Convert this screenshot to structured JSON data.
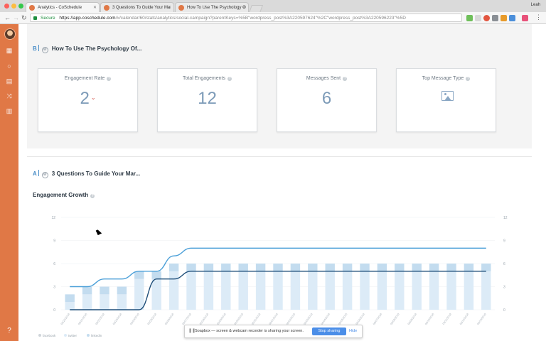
{
  "browser": {
    "tabs": [
      {
        "label": "Analytics - CoSchedule",
        "active": true
      },
      {
        "label": "3 Questions To Guide Your Ma",
        "active": false
      },
      {
        "label": "How To Use The Psychology O",
        "active": false
      }
    ],
    "user": "Leah",
    "secure_label": "Secure",
    "url_host": "https://app.coschedule.com",
    "url_path": "/#/calendar/60/stats/analytics/social-campaign?parentKeys=%5B\"wordpress_post%3A220597624\"%2C\"wordpress_post%3A220596223\"%5D"
  },
  "section_b": {
    "letter": "B",
    "title": "How To Use The Psychology Of...",
    "cards": [
      {
        "title": "Engagement Rate",
        "value": "2",
        "trend": "down"
      },
      {
        "title": "Total Engagements",
        "value": "12"
      },
      {
        "title": "Messages Sent",
        "value": "6"
      },
      {
        "title": "Top Message Type",
        "icon": "image-icon"
      }
    ]
  },
  "section_a": {
    "letter": "A",
    "title": "3 Questions To Guide Your Mar..."
  },
  "engagement_growth": {
    "title": "Engagement Growth",
    "legend": [
      "facebook",
      "twitter",
      "linkedin"
    ]
  },
  "chart_data": {
    "type": "bar",
    "ylim": [
      0,
      12
    ],
    "y_ticks": [
      0,
      3,
      6,
      9,
      12
    ],
    "right_y_ticks": [
      0,
      3,
      6,
      9,
      12
    ],
    "categories": [
      "05/20/2018",
      "05/21/2018",
      "05/22/2018",
      "05/23/2018",
      "05/24/2018",
      "05/25/2018",
      "05/26/2018",
      "05/27/2018",
      "05/28/2018",
      "05/29/2018",
      "05/30/2018",
      "05/31/2018",
      "06/01/2018",
      "06/02/2018",
      "06/03/2018",
      "06/04/2018",
      "06/05/2018",
      "06/06/2018",
      "06/07/2018",
      "06/08/2018",
      "06/09/2018",
      "06/10/2018",
      "06/11/2018",
      "06/12/2018",
      "06/13/2018"
    ],
    "series": [
      {
        "name": "facebook",
        "kind": "bar",
        "values": [
          0,
          0,
          0,
          0,
          0,
          0,
          0,
          0,
          0,
          0,
          0,
          0,
          0,
          0,
          0,
          0,
          0,
          0,
          0,
          0,
          0,
          0,
          0,
          0,
          0
        ]
      },
      {
        "name": "twitter",
        "kind": "bar",
        "values": [
          1,
          2,
          2,
          2,
          4,
          4,
          5,
          5,
          5,
          5,
          5,
          5,
          5,
          5,
          5,
          5,
          5,
          5,
          5,
          5,
          5,
          5,
          5,
          5,
          5
        ]
      },
      {
        "name": "linkedin",
        "kind": "bar",
        "values": [
          1,
          1,
          1,
          1,
          1,
          1,
          1,
          1,
          1,
          1,
          1,
          1,
          1,
          1,
          1,
          1,
          1,
          1,
          1,
          1,
          1,
          1,
          1,
          1,
          1
        ]
      },
      {
        "kind": "line",
        "color": "#4a9fd8",
        "values": [
          3,
          3,
          4,
          4,
          5,
          5,
          7,
          8,
          8,
          8,
          8,
          8,
          8,
          8,
          8,
          8,
          8,
          8,
          8,
          8,
          8,
          8,
          8,
          8,
          8
        ]
      },
      {
        "kind": "line",
        "color": "#1f4f7a",
        "values": [
          0,
          0,
          0,
          0,
          0,
          4,
          4,
          5,
          5,
          5,
          5,
          5,
          5,
          5,
          5,
          5,
          5,
          5,
          5,
          5,
          5,
          5,
          5,
          5,
          5
        ]
      }
    ],
    "colors": {
      "facebook": "#cfd5da",
      "twitter": "#dcebf7",
      "linkedin": "#c3dcef"
    }
  },
  "soapbox": {
    "message": "Soapbox — screen & webcam recorder is sharing your screen.",
    "stop_label": "Stop sharing",
    "hide_label": "Hide"
  }
}
